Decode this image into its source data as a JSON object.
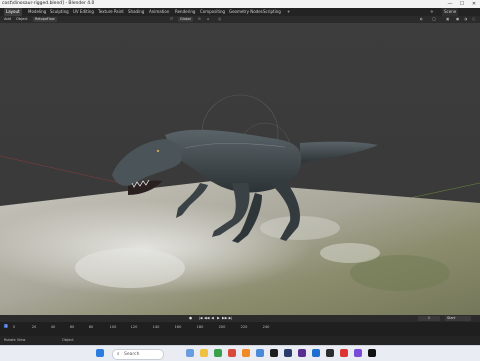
{
  "window": {
    "title": "cost\\dinosaur-rigged.blend] - Blender 4.0",
    "min": "—",
    "max": "☐",
    "close": "✕"
  },
  "workspaces": [
    "Layout",
    "Modeling",
    "Sculpting",
    "UV Editing",
    "Texture Paint",
    "Shading",
    "Animation",
    "Rendering",
    "Compositing",
    "Geometry Nodes",
    "Scripting",
    "+"
  ],
  "active_workspace": "Layout",
  "scene": {
    "label": "Scene"
  },
  "header": {
    "mode": "Add",
    "object": "Object",
    "shading": "RetopoFlow",
    "transform": "Global"
  },
  "timeline": {
    "controls": [
      "|◀",
      "◀◀",
      "◀",
      "▶",
      "▶▶",
      "▶|"
    ],
    "current_frame": "1",
    "start_label": "Start",
    "ticks": [
      "0",
      "20",
      "40",
      "60",
      "80",
      "100",
      "120",
      "140",
      "160",
      "180",
      "200",
      "220",
      "240"
    ],
    "active_tick": "1"
  },
  "status": {
    "left": "Rotate View",
    "mid": "Object"
  },
  "taskbar": {
    "search_placeholder": "Search"
  }
}
